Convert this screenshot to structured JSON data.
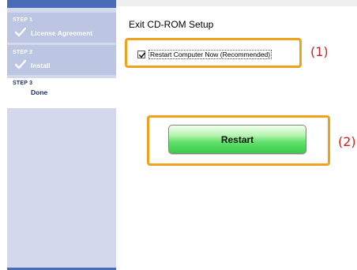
{
  "sidebar": {
    "steps": [
      {
        "number": "STEP 1",
        "label": "License Agreement",
        "status": "done"
      },
      {
        "number": "STEP 2",
        "label": "Install",
        "status": "done"
      },
      {
        "number": "STEP 3",
        "label": "Done",
        "status": "current"
      }
    ]
  },
  "main": {
    "title": "Exit CD-ROM Setup",
    "checkbox": {
      "label": "Restart Computer Now (Recommended)",
      "checked": true
    },
    "restart_label": "Restart"
  },
  "callouts": {
    "label_1": "(1)",
    "label_2": "(2)",
    "color": "#f2a11c",
    "label_color": "#d01e1e"
  },
  "colors": {
    "sidebar_bg": "#d3d8ed",
    "sidebar_accent": "#4a6bb8",
    "button_green": "#3ccb4d"
  }
}
